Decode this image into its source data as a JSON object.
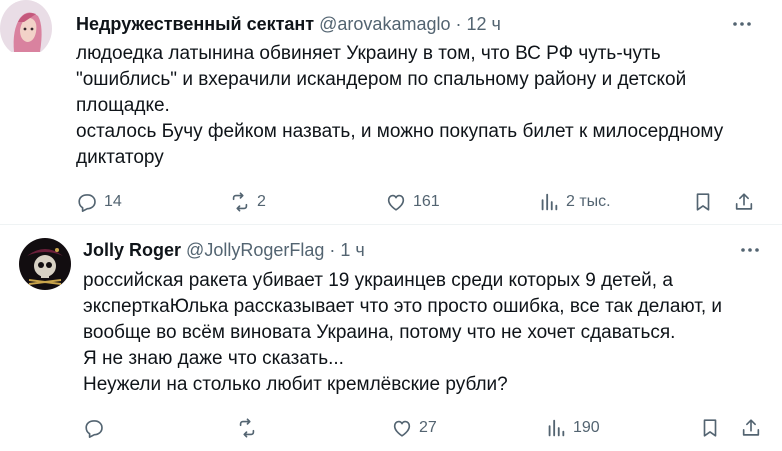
{
  "tweets": [
    {
      "author_name": "Недружественный сектант",
      "handle": "@arovakamaglo",
      "separator": "·",
      "time": "12 ч",
      "lines": [
        "людоедка латынина обвиняет Украину в том, что ВС РФ чуть-чуть",
        "\"ошиблись\" и вхерачили искандером по спальному району и детской",
        "площадке.",
        "осталось Бучу фейком назвать, и можно покупать билет к милосердному",
        "диктатору"
      ],
      "replies": "14",
      "reposts": "2",
      "likes": "161",
      "views": "2 тыс."
    },
    {
      "author_name": "Jolly Roger",
      "handle": "@JollyRogerFlag",
      "separator": "·",
      "time": "1 ч",
      "lines": [
        "российская ракета убивает 19 украинцев среди которых 9 детей, а",
        "эксперткаЮлька рассказывает что это просто ошибка, все так делают, и",
        "вообще во всём виновата Украина, потому что не хочет сдаваться.",
        "Я не знаю даже что сказать...",
        "Неужели на столько любит кремлёвские рубли?"
      ],
      "replies": "",
      "reposts": "",
      "likes": "27",
      "views": "190"
    }
  ],
  "colors": {
    "text": "#0f1419",
    "secondary": "#536471",
    "divider": "#eff3f4"
  },
  "icons": [
    "reply-icon",
    "repost-icon",
    "like-icon",
    "views-icon",
    "bookmark-icon",
    "share-icon",
    "more-icon"
  ]
}
